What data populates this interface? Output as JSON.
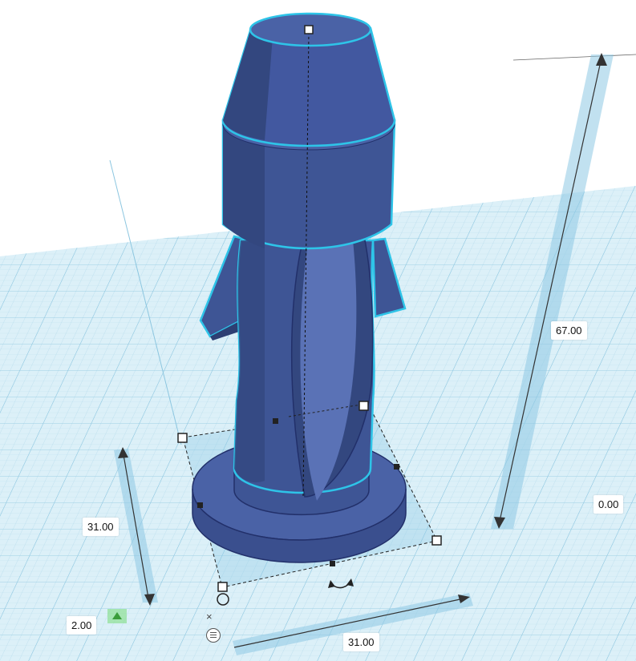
{
  "dimensions": {
    "height": "67.00",
    "elevation": "0.00",
    "width": "31.00",
    "length": "31.00",
    "lift": "2.00"
  },
  "colors": {
    "workplane": "#d6ecf6",
    "grid_line": "#a9d6ea",
    "shape_fill": "#3e5595",
    "shape_dark": "#2d3f73",
    "outline": "#2ec4e8",
    "ruler": "#8ec9e3"
  },
  "icons": {
    "close": "×",
    "menu": "menu-icon",
    "rotate": "rotate-arrow-icon",
    "lift": "lift-arrow-icon"
  }
}
